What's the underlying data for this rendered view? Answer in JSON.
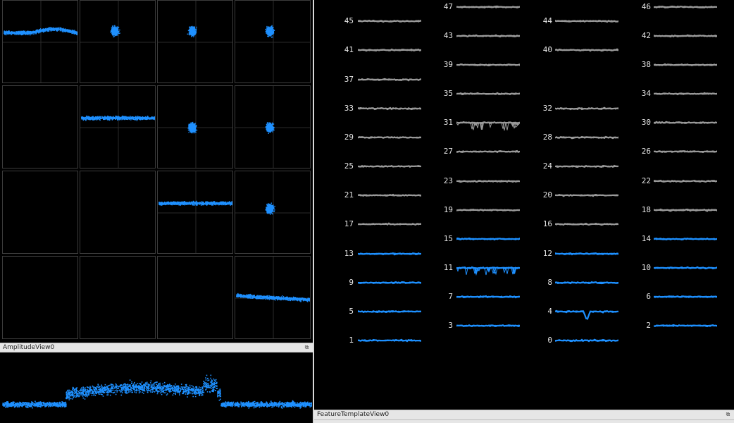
{
  "colors": {
    "cluster": "#1e90ff",
    "inactive": "#9a9a9a",
    "background": "#000000",
    "grid_border": "#3c3c3c",
    "axis": "#2a2a2a"
  },
  "amplitude_view": {
    "title": "AmplitudeView0",
    "float_icon": "float-window-icon"
  },
  "feature_template_view": {
    "title": "FeatureTemplateView0",
    "float_icon": "float-window-icon"
  },
  "feature_grid": {
    "rows": 4,
    "cols": 4,
    "cells": [
      {
        "r": 0,
        "c": 0,
        "type": "band"
      },
      {
        "r": 0,
        "c": 1,
        "type": "blob"
      },
      {
        "r": 0,
        "c": 2,
        "type": "blob"
      },
      {
        "r": 0,
        "c": 3,
        "type": "blob"
      },
      {
        "r": 1,
        "c": 0,
        "type": "empty"
      },
      {
        "r": 1,
        "c": 1,
        "type": "band"
      },
      {
        "r": 1,
        "c": 2,
        "type": "blob"
      },
      {
        "r": 1,
        "c": 3,
        "type": "blob"
      },
      {
        "r": 2,
        "c": 0,
        "type": "empty"
      },
      {
        "r": 2,
        "c": 1,
        "type": "empty"
      },
      {
        "r": 2,
        "c": 2,
        "type": "band"
      },
      {
        "r": 2,
        "c": 3,
        "type": "blob"
      },
      {
        "r": 3,
        "c": 0,
        "type": "empty"
      },
      {
        "r": 3,
        "c": 1,
        "type": "empty"
      },
      {
        "r": 3,
        "c": 2,
        "type": "empty"
      },
      {
        "r": 3,
        "c": 3,
        "type": "band"
      }
    ]
  },
  "channels": [
    {
      "label": "47",
      "col": 1,
      "active": false
    },
    {
      "label": "46",
      "col": 3,
      "active": false
    },
    {
      "label": "45",
      "col": 0,
      "active": false
    },
    {
      "label": "44",
      "col": 2,
      "active": false
    },
    {
      "label": "43",
      "col": 1,
      "active": false
    },
    {
      "label": "42",
      "col": 3,
      "active": false
    },
    {
      "label": "41",
      "col": 0,
      "active": false
    },
    {
      "label": "40",
      "col": 2,
      "active": false
    },
    {
      "label": "39",
      "col": 1,
      "active": false
    },
    {
      "label": "38",
      "col": 3,
      "active": false
    },
    {
      "label": "37",
      "col": 0,
      "active": false
    },
    {
      "label": "35",
      "col": 1,
      "active": false
    },
    {
      "label": "34",
      "col": 3,
      "active": false
    },
    {
      "label": "33",
      "col": 0,
      "active": false
    },
    {
      "label": "32",
      "col": 2,
      "active": false
    },
    {
      "label": "31",
      "col": 1,
      "active": false,
      "spiky": true
    },
    {
      "label": "30",
      "col": 3,
      "active": false
    },
    {
      "label": "29",
      "col": 0,
      "active": false
    },
    {
      "label": "28",
      "col": 2,
      "active": false
    },
    {
      "label": "27",
      "col": 1,
      "active": false
    },
    {
      "label": "26",
      "col": 3,
      "active": false
    },
    {
      "label": "25",
      "col": 0,
      "active": false
    },
    {
      "label": "24",
      "col": 2,
      "active": false
    },
    {
      "label": "23",
      "col": 1,
      "active": false
    },
    {
      "label": "22",
      "col": 3,
      "active": false
    },
    {
      "label": "21",
      "col": 0,
      "active": false
    },
    {
      "label": "20",
      "col": 2,
      "active": false
    },
    {
      "label": "19",
      "col": 1,
      "active": false
    },
    {
      "label": "18",
      "col": 3,
      "active": false
    },
    {
      "label": "17",
      "col": 0,
      "active": false
    },
    {
      "label": "16",
      "col": 2,
      "active": false
    },
    {
      "label": "15",
      "col": 1,
      "active": true
    },
    {
      "label": "14",
      "col": 3,
      "active": true
    },
    {
      "label": "13",
      "col": 0,
      "active": true
    },
    {
      "label": "12",
      "col": 2,
      "active": true
    },
    {
      "label": "11",
      "col": 1,
      "active": true,
      "spiky": true
    },
    {
      "label": "10",
      "col": 3,
      "active": true
    },
    {
      "label": "9",
      "col": 0,
      "active": true
    },
    {
      "label": "8",
      "col": 2,
      "active": true
    },
    {
      "label": "7",
      "col": 1,
      "active": true
    },
    {
      "label": "6",
      "col": 3,
      "active": true
    },
    {
      "label": "5",
      "col": 0,
      "active": true
    },
    {
      "label": "4",
      "col": 2,
      "active": true,
      "spike": true
    },
    {
      "label": "3",
      "col": 1,
      "active": true
    },
    {
      "label": "2",
      "col": 3,
      "active": true
    },
    {
      "label": "1",
      "col": 0,
      "active": true
    },
    {
      "label": "0",
      "col": 2,
      "active": true
    }
  ]
}
